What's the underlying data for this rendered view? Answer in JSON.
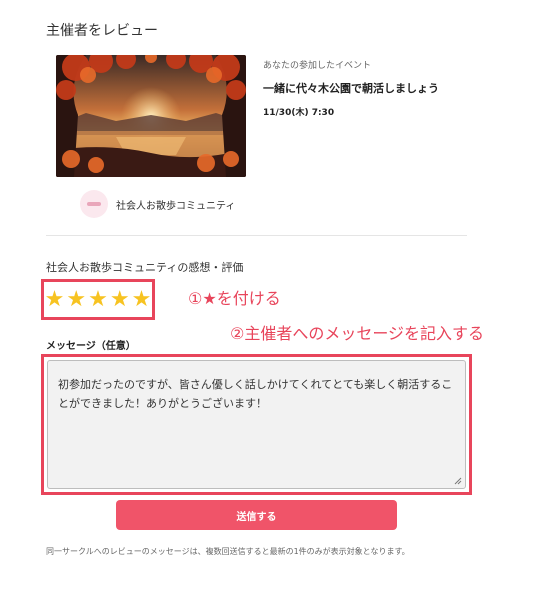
{
  "page": {
    "title": "主催者をレビュー"
  },
  "event": {
    "subtitle": "あなたの参加したイベント",
    "name": "一緒に代々木公園で朝活しましょう",
    "date": "11/30(木) 7:30"
  },
  "organizer": {
    "name": "社会人お散歩コミュニティ"
  },
  "rating": {
    "label": "社会人お散歩コミュニティの感想・評価",
    "value": 5,
    "max": 5,
    "star_glyph": "★"
  },
  "annotations": {
    "step1": "①★を付ける",
    "step2": "②主催者へのメッセージを記入する"
  },
  "message": {
    "label": "メッセージ（任意）",
    "value": "初参加だったのですが、皆さん優しく話しかけてくれてとても楽しく朝活することができました！ありがとうございます！"
  },
  "submit": {
    "label": "送信する"
  },
  "note": "同一サークルへのレビューのメッセージは、複数回送信すると最新の1件のみが表示対象となります。",
  "colors": {
    "accent": "#e8455b",
    "button": "#f05469",
    "star": "#f7c321"
  }
}
